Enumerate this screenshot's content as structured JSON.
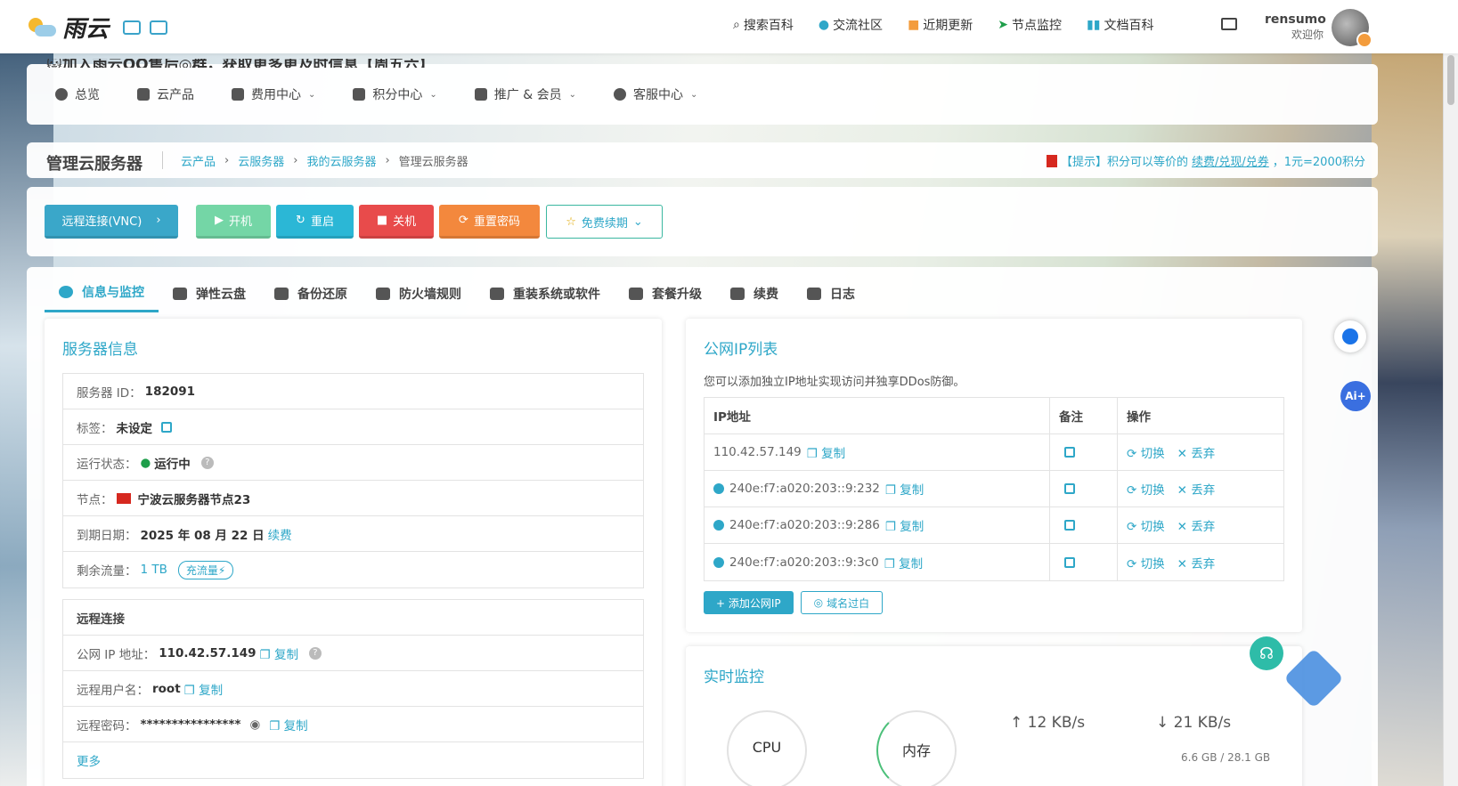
{
  "brand": {
    "name": "雨云"
  },
  "nav": {
    "items": [
      {
        "icon": "search-icon",
        "label": "搜索百科"
      },
      {
        "icon": "bell-icon",
        "label": "交流社区"
      },
      {
        "icon": "news-icon",
        "label": "近期更新"
      },
      {
        "icon": "send-icon",
        "label": "节点监控"
      },
      {
        "icon": "book-icon",
        "label": "文档百科"
      }
    ]
  },
  "user": {
    "name": "rensumo",
    "greeting": "欢迎你"
  },
  "announce": "🐱加入雨云QQ售后◎群，获取更多更及时信息【周五六】",
  "menu": [
    {
      "label": "总览",
      "caret": false
    },
    {
      "label": "云产品",
      "caret": false
    },
    {
      "label": "费用中心",
      "caret": true
    },
    {
      "label": "积分中心",
      "caret": true
    },
    {
      "label": "推广 & 会员",
      "caret": true
    },
    {
      "label": "客服中心",
      "caret": true
    }
  ],
  "breadcrumb": {
    "title": "管理云服务器",
    "items": [
      "云产品",
      "云服务器",
      "我的云服务器",
      "管理云服务器"
    ]
  },
  "tip": {
    "prefix": "【提示】积分可以等价的",
    "link": "续费/兑现/兑券",
    "suffix": "，1元=2000积分"
  },
  "actions": {
    "vnc": "远程连接(VNC)",
    "start": "开机",
    "restart": "重启",
    "shutdown": "关机",
    "reset_pwd": "重置密码",
    "free_renew": "免费续期"
  },
  "tabs": [
    "信息与监控",
    "弹性云盘",
    "备份还原",
    "防火墙规则",
    "重装系统或软件",
    "套餐升级",
    "续费",
    "日志"
  ],
  "server_info": {
    "title": "服务器信息",
    "id_label": "服务器 ID：",
    "id": "182091",
    "tag_label": "标签：",
    "tag": "未设定",
    "status_label": "运行状态：",
    "status": "运行中",
    "node_label": "节点：",
    "node": "宁波云服务器节点23",
    "expire_label": "到期日期：",
    "expire": "2025 年 08 月 22 日",
    "renew": "续费",
    "traffic_label": "剩余流量：",
    "traffic": "1 TB",
    "recharge": "充流量⚡"
  },
  "remote": {
    "title": "远程连接",
    "ip_label": "公网 IP 地址：",
    "ip": "110.42.57.149",
    "copy": "复制",
    "user_label": "远程用户名：",
    "user": "root",
    "pwd_label": "远程密码：",
    "pwd": "****************",
    "more": "更多"
  },
  "ip_list": {
    "title": "公网IP列表",
    "desc": "您可以添加独立IP地址实现访问并独享DDos防御。",
    "headers": [
      "IP地址",
      "备注",
      "操作"
    ],
    "rows": [
      {
        "ip": "110.42.57.149",
        "v6": false
      },
      {
        "ip": "240e:f7:a020:203::9:232",
        "v6": true
      },
      {
        "ip": "240e:f7:a020:203::9:286",
        "v6": true
      },
      {
        "ip": "240e:f7:a020:203::9:3c0",
        "v6": true
      }
    ],
    "copy": "复制",
    "switch": "切换",
    "discard": "丢弃",
    "add": "+ 添加公网IP",
    "domain": "域名过白"
  },
  "monitor": {
    "title": "实时监控",
    "cpu": "CPU",
    "mem": "内存",
    "up": "↑ 12 KB/s",
    "down": "↓ 21 KB/s",
    "mem_usage": "6.6 GB / 28.1 GB"
  }
}
